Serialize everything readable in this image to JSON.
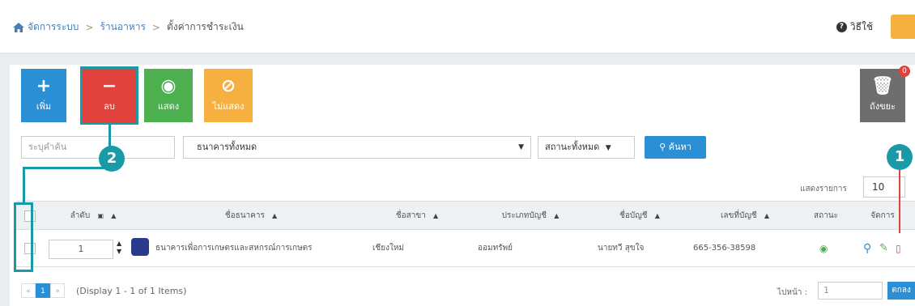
{
  "breadcrumb": {
    "items": [
      "จัดการระบบ",
      "ร้านอาหาร",
      "ตั้งค่าการชำระเงิน"
    ]
  },
  "header": {
    "help_label": "วิธีใช้"
  },
  "toolbar": {
    "add_label": "เพิ่ม",
    "delete_label": "ลบ",
    "show_label": "แสดง",
    "hide_label": "ไม่แสดง",
    "trash_label": "ถังขยะ",
    "trash_count": "0"
  },
  "filters": {
    "search_placeholder": "ระบุคำค้น",
    "bank_value": "ธนาคารทั้งหมด",
    "status_value": "สถานะทั้งหมด",
    "search_button": "ค้นหา"
  },
  "per_page": {
    "label": "แสดงรายการ",
    "value": "10"
  },
  "table": {
    "headers": [
      "ลำดับ",
      "ชื่อธนาคาร",
      "ชื่อสาขา",
      "ประเภทบัญชี",
      "ชื่อบัญชี",
      "เลขที่บัญชี",
      "สถานะ",
      "จัดการ"
    ],
    "rows": [
      {
        "order": "1",
        "bank": "ธนาคารเพื่อการเกษตรและสหกรณ์การเกษตร",
        "branch": "เชียงใหม่",
        "account_type": "ออมทรัพย์",
        "account_name": "นายทวี สุขใจ",
        "account_no": "665-356-38598"
      }
    ]
  },
  "pagination": {
    "current_page": "1",
    "info": "(Display 1 - 1 of 1 Items)",
    "goto_label": "ไปหน้า :",
    "goto_value": "1",
    "ok_label": "ตกลง"
  },
  "markers": {
    "one": "1",
    "two": "2"
  },
  "colors": {
    "primary": "#2b8fd6",
    "danger": "#e0423d",
    "success": "#4caf50",
    "warning": "#f5b040",
    "annotation": "#1a9aa6"
  }
}
